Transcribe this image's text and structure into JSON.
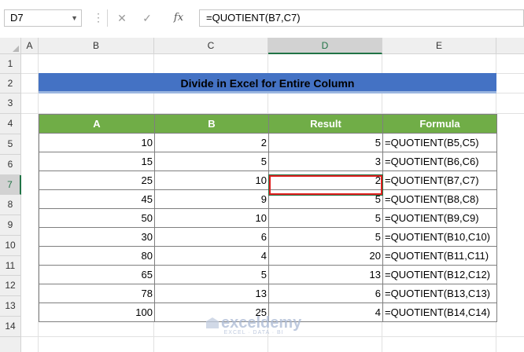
{
  "formula_bar": {
    "name_box": "D7",
    "fx_label": "fx",
    "formula": "=QUOTIENT(B7,C7)"
  },
  "columns": [
    "A",
    "B",
    "C",
    "D",
    "E"
  ],
  "rows": [
    "1",
    "2",
    "3",
    "4",
    "5",
    "6",
    "7",
    "8",
    "9",
    "10",
    "11",
    "12",
    "13",
    "14"
  ],
  "title": "Divide in Excel for Entire Column",
  "table": {
    "headers": [
      "A",
      "B",
      "Result",
      "Formula"
    ],
    "rows": [
      [
        "10",
        "2",
        "5",
        "=QUOTIENT(B5,C5)"
      ],
      [
        "15",
        "5",
        "3",
        "=QUOTIENT(B6,C6)"
      ],
      [
        "25",
        "10",
        "2",
        "=QUOTIENT(B7,C7)"
      ],
      [
        "45",
        "9",
        "5",
        "=QUOTIENT(B8,C8)"
      ],
      [
        "50",
        "10",
        "5",
        "=QUOTIENT(B9,C9)"
      ],
      [
        "30",
        "6",
        "5",
        "=QUOTIENT(B10,C10)"
      ],
      [
        "80",
        "4",
        "20",
        "=QUOTIENT(B11,C11)"
      ],
      [
        "65",
        "5",
        "13",
        "=QUOTIENT(B12,C12)"
      ],
      [
        "78",
        "13",
        "6",
        "=QUOTIENT(B13,C13)"
      ],
      [
        "100",
        "25",
        "4",
        "=QUOTIENT(B14,C14)"
      ]
    ]
  },
  "watermark": {
    "brand": "exceldemy",
    "tagline": "EXCEL · DATA · BI"
  },
  "colors": {
    "header_green": "#70ad47",
    "title_blue": "#4472c4",
    "selection_green": "#217346",
    "highlight_red": "#e02020"
  }
}
